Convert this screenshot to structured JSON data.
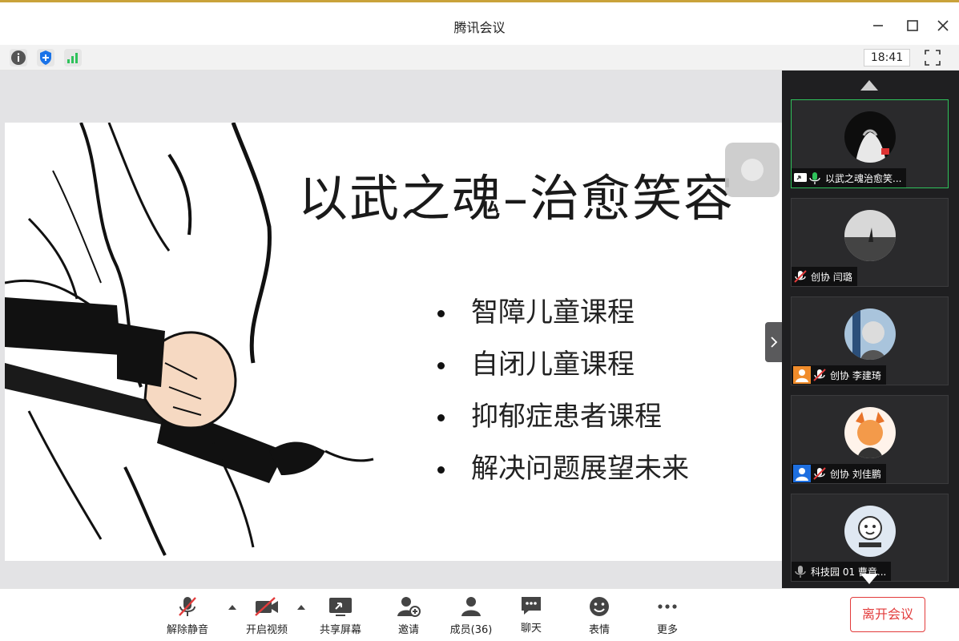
{
  "window": {
    "title": "腾讯会议"
  },
  "status": {
    "time": "18:41"
  },
  "slide": {
    "title": "以武之魂–治愈笑容",
    "bullets": [
      "智障儿童课程",
      "自闭儿童课程",
      "抑郁症患者课程",
      "解决问题展望未来"
    ]
  },
  "participants": [
    {
      "name": "以武之魂治愈笑...",
      "mic": "on",
      "sharing": true,
      "active": true
    },
    {
      "name": "创协 闫璐",
      "mic": "muted"
    },
    {
      "name": "创协 李建琦",
      "mic": "muted",
      "badge": "user-icon"
    },
    {
      "name": "创协 刘佳鹏",
      "mic": "muted",
      "badge": "user-icon"
    },
    {
      "name": "科技园 01 曹竟...",
      "mic": "idle"
    }
  ],
  "toolbar": {
    "unmute": "解除静音",
    "video": "开启视频",
    "share": "共享屏幕",
    "invite": "邀请",
    "members": "成员(36)",
    "chat": "聊天",
    "emoji": "表情",
    "more": "更多",
    "leave": "离开会议"
  },
  "colors": {
    "accent_green": "#2fc25b",
    "leave_red": "#e23b3b",
    "shield_blue": "#1a73e8",
    "badge_orange": "#f08c2b",
    "badge_blue": "#1e6fe0"
  }
}
